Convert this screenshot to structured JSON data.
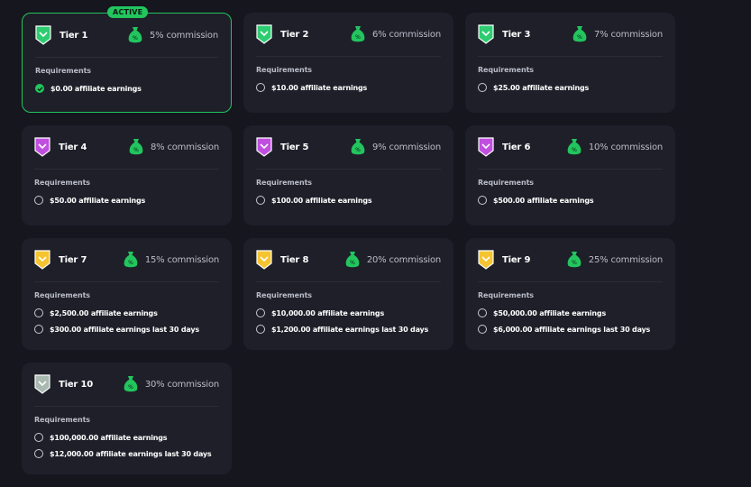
{
  "active_label": "ACTIVE",
  "requirements_label": "Requirements",
  "colors": {
    "active": "#22c55e",
    "card": "#1e1f29",
    "background": "#15161e"
  },
  "tiers": [
    {
      "name": "Tier 1",
      "commission": "5% commission",
      "active": true,
      "badge_color": "#2ecc71",
      "requirements": [
        {
          "text": "$0.00 affiliate earnings",
          "completed": true
        }
      ]
    },
    {
      "name": "Tier 2",
      "commission": "6% commission",
      "badge_color": "#2ecc71",
      "requirements": [
        {
          "text": "$10.00 affiliate earnings",
          "completed": false
        }
      ]
    },
    {
      "name": "Tier 3",
      "commission": "7% commission",
      "badge_color": "#2ecc71",
      "requirements": [
        {
          "text": "$25.00 affiliate earnings",
          "completed": false
        }
      ]
    },
    {
      "name": "Tier 4",
      "commission": "8% commission",
      "badge_color": "#c04fe0",
      "requirements": [
        {
          "text": "$50.00 affiliate earnings",
          "completed": false
        }
      ]
    },
    {
      "name": "Tier 5",
      "commission": "9% commission",
      "badge_color": "#c04fe0",
      "requirements": [
        {
          "text": "$100.00 affiliate earnings",
          "completed": false
        }
      ]
    },
    {
      "name": "Tier 6",
      "commission": "10% commission",
      "badge_color": "#c04fe0",
      "requirements": [
        {
          "text": "$500.00 affiliate earnings",
          "completed": false
        }
      ]
    },
    {
      "name": "Tier 7",
      "commission": "15% commission",
      "badge_color": "#f5c430",
      "requirements": [
        {
          "text": "$2,500.00 affiliate earnings",
          "completed": false
        },
        {
          "text": "$300.00 affiliate earnings last 30 days",
          "completed": false
        }
      ]
    },
    {
      "name": "Tier 8",
      "commission": "20% commission",
      "badge_color": "#f5c430",
      "requirements": [
        {
          "text": "$10,000.00 affiliate earnings",
          "completed": false
        },
        {
          "text": "$1,200.00 affiliate earnings last 30 days",
          "completed": false
        }
      ]
    },
    {
      "name": "Tier 9",
      "commission": "25% commission",
      "badge_color": "#f5c430",
      "requirements": [
        {
          "text": "$50,000.00 affiliate earnings",
          "completed": false
        },
        {
          "text": "$6,000.00 affiliate earnings last 30 days",
          "completed": false
        }
      ]
    },
    {
      "name": "Tier 10",
      "commission": "30% commission",
      "badge_color": "#a9b8b0",
      "requirements": [
        {
          "text": "$100,000.00 affiliate earnings",
          "completed": false
        },
        {
          "text": "$12,000.00 affiliate earnings last 30 days",
          "completed": false
        }
      ]
    }
  ]
}
